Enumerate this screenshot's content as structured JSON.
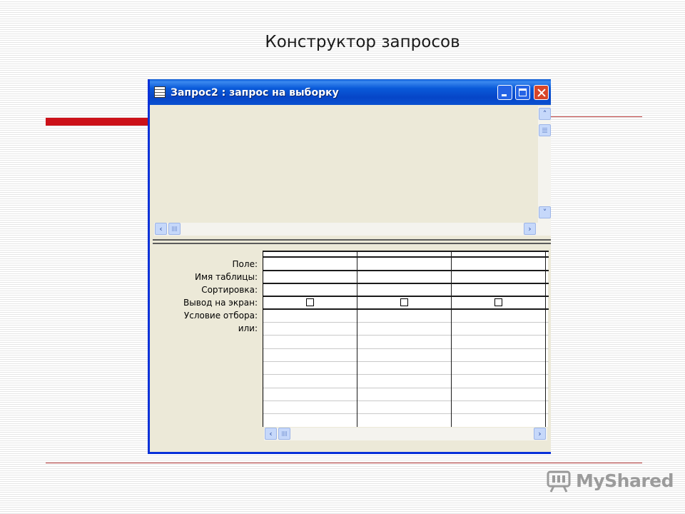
{
  "slide": {
    "title": "Конструктор запросов",
    "accent_color": "#cc1119"
  },
  "window": {
    "title": "Запрос2 : запрос на выборку",
    "icon": "query-window-icon",
    "titlebar_color": "#0a5ad9",
    "buttons": {
      "minimize_icon": "minimize-icon",
      "maximize_icon": "maximize-icon",
      "close_icon": "close-icon"
    }
  },
  "scroll": {
    "left": "‹",
    "right": "›",
    "up": "˄",
    "down": "˅"
  },
  "design_grid": {
    "row_labels": [
      "Поле:",
      "Имя таблицы:",
      "Сортировка:",
      "Вывод на экран:",
      "Условие отбора:",
      "или:"
    ],
    "columns": [
      {
        "field": "",
        "table": "",
        "sort": "",
        "show": false,
        "criteria": "",
        "or": ""
      },
      {
        "field": "",
        "table": "",
        "sort": "",
        "show": false,
        "criteria": "",
        "or": ""
      },
      {
        "field": "",
        "table": "",
        "sort": "",
        "show": false,
        "criteria": "",
        "or": ""
      }
    ]
  },
  "watermark": {
    "text": "MyShared",
    "icon": "myshared-logo-icon"
  }
}
